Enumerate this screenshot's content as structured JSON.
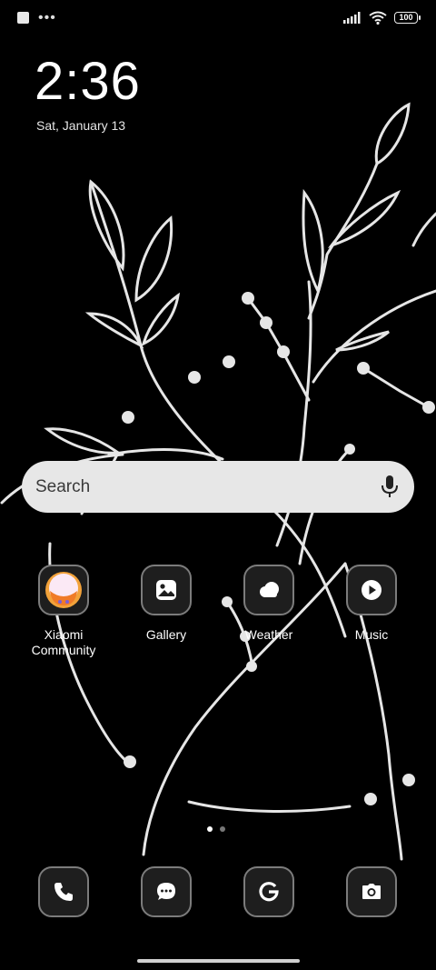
{
  "status_bar": {
    "left_icons": [
      "notification-square-icon",
      "more-dots-icon"
    ],
    "battery": "100",
    "right_icons": [
      "signal-icon",
      "wifi-icon",
      "battery-icon"
    ]
  },
  "clock": {
    "time": "2:36",
    "date": "Sat, January 13"
  },
  "search": {
    "placeholder": "Search",
    "icon": "mic-icon"
  },
  "apps": [
    {
      "label": "Xiaomi Community",
      "icon": "xiaomi-community-icon"
    },
    {
      "label": "Gallery",
      "icon": "gallery-icon"
    },
    {
      "label": "Weather",
      "icon": "weather-icon"
    },
    {
      "label": "Music",
      "icon": "music-icon"
    }
  ],
  "page_indicator": {
    "pages": 2,
    "active": 1
  },
  "dock": [
    {
      "icon": "phone-icon"
    },
    {
      "icon": "messages-icon"
    },
    {
      "icon": "google-icon"
    },
    {
      "icon": "camera-icon"
    }
  ],
  "colors": {
    "background": "#000000",
    "search_bar": "#e7e7e7",
    "icon_bg": "#1e1e1e",
    "icon_border": "#7c7c7c"
  }
}
